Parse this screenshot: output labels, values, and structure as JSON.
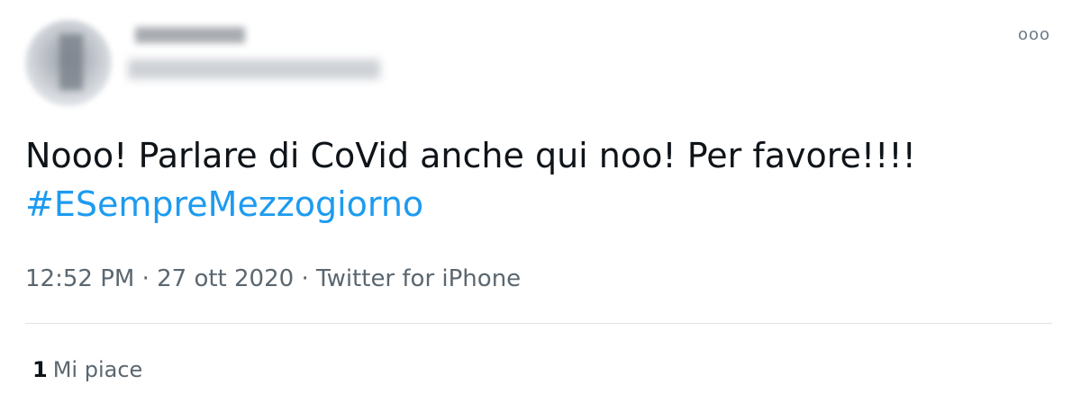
{
  "tweet": {
    "text": "Nooo! Parlare di CoVid anche qui noo! Per favore!!!!",
    "hashtag": "#ESempreMezzogiorno",
    "time": "12:52 PM",
    "separator1": "·",
    "date": "27 ott 2020",
    "separator2": "·",
    "source": "Twitter for iPhone",
    "likes_count": "1",
    "likes_label": "Mi piace",
    "more_icon": "ooo"
  },
  "icons": {
    "more": "more-options-icon"
  },
  "colors": {
    "text": "#0f1419",
    "secondary": "#5b6770",
    "link": "#1d9bf0",
    "divider": "#dfe3e6"
  }
}
